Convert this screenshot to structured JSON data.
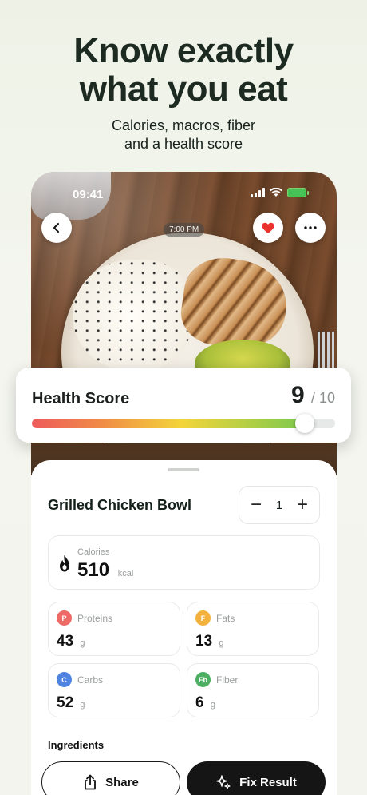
{
  "marketing": {
    "headline_line1": "Know exactly",
    "headline_line2": "what you eat",
    "subhead_line1": "Calories, macros, fiber",
    "subhead_line2": "and a health score"
  },
  "status_bar": {
    "time": "09:41"
  },
  "photo": {
    "timestamp": "7:00 PM"
  },
  "health": {
    "label": "Health Score",
    "score": "9",
    "max": "/ 10",
    "level": 0.9,
    "colors": {
      "red": "#ee5b5b",
      "yellow": "#f3d53a",
      "green": "#7cc94c"
    }
  },
  "meal": {
    "name": "Grilled Chicken Bowl",
    "quantity": "1",
    "minus": "−",
    "plus": "+"
  },
  "calories": {
    "label": "Calories",
    "value": "510",
    "unit": "kcal"
  },
  "macros": {
    "proteins": {
      "badge": "P",
      "label": "Proteins",
      "value": "43",
      "unit": "g",
      "color": "#ee6a67"
    },
    "fats": {
      "badge": "F",
      "label": "Fats",
      "value": "13",
      "unit": "g",
      "color": "#f2b23d"
    },
    "carbs": {
      "badge": "C",
      "label": "Carbs",
      "value": "52",
      "unit": "g",
      "color": "#4f83e0"
    },
    "fiber": {
      "badge": "Fb",
      "label": "Fiber",
      "value": "6",
      "unit": "g",
      "color": "#4cae61"
    }
  },
  "ingredients": {
    "title": "Ingredients"
  },
  "actions": {
    "share": "Share",
    "fix": "Fix Result"
  }
}
